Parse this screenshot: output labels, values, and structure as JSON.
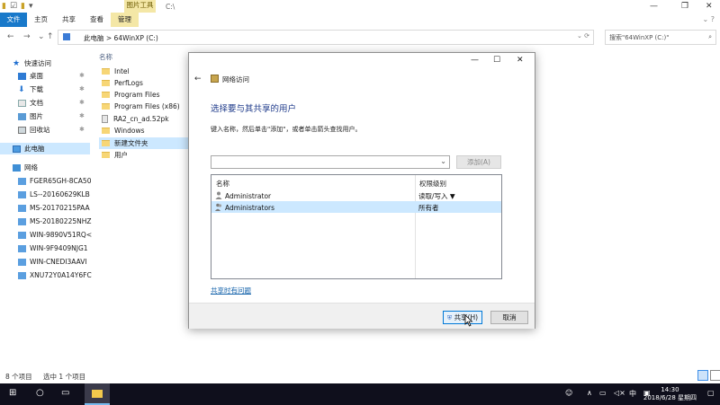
{
  "window": {
    "ribbon_context_label": "图片工具",
    "title_path": "C:\\",
    "tabs": [
      "文件",
      "主页",
      "共享",
      "查看",
      "管理"
    ]
  },
  "address": {
    "path": "此电脑 > 64WinXP (C:)",
    "search_placeholder": "搜索\"64WinXP (C:)\""
  },
  "sidebar": {
    "quick_access": "快速访问",
    "quick_items": [
      "桌面",
      "下载",
      "文档",
      "图片",
      "回收站"
    ],
    "this_pc": "此电脑",
    "network": "网络",
    "network_items": [
      "FGER65GH-8CA50",
      "LS--20160629KLB",
      "MS-20170215PAA",
      "MS-20180225NHZ",
      "WIN-9890V51RQ<",
      "WIN-9F9409NJG1",
      "WIN-CNEDI3AAVI",
      "XNU72Y0A14Y6FC"
    ]
  },
  "files": {
    "column_name": "名称",
    "items": [
      "Intel",
      "PerfLogs",
      "Program Files",
      "Program Files (x86)",
      "RA2_cn_ad.52pk",
      "Windows",
      "新建文件夹",
      "用户"
    ]
  },
  "status": {
    "count": "8 个项目",
    "selected": "选中 1 个项目"
  },
  "dialog": {
    "title": "网络访问",
    "heading": "选择要与其共享的用户",
    "instruction": "键入名称，然后单击\"添加\"，或者单击箭头查找用户。",
    "add_button": "添加(A)",
    "columns": {
      "name": "名称",
      "permission": "权限级别"
    },
    "rows": [
      {
        "name": "Administrator",
        "permission": "读取/写入 ▼"
      },
      {
        "name": "Administrators",
        "permission": "所有者"
      }
    ],
    "help_link": "共享时有问题",
    "share_button": "共享(H)",
    "cancel_button": "取消"
  },
  "taskbar": {
    "ime": "中",
    "time": "14:30",
    "date": "2018/6/28 星期四"
  }
}
